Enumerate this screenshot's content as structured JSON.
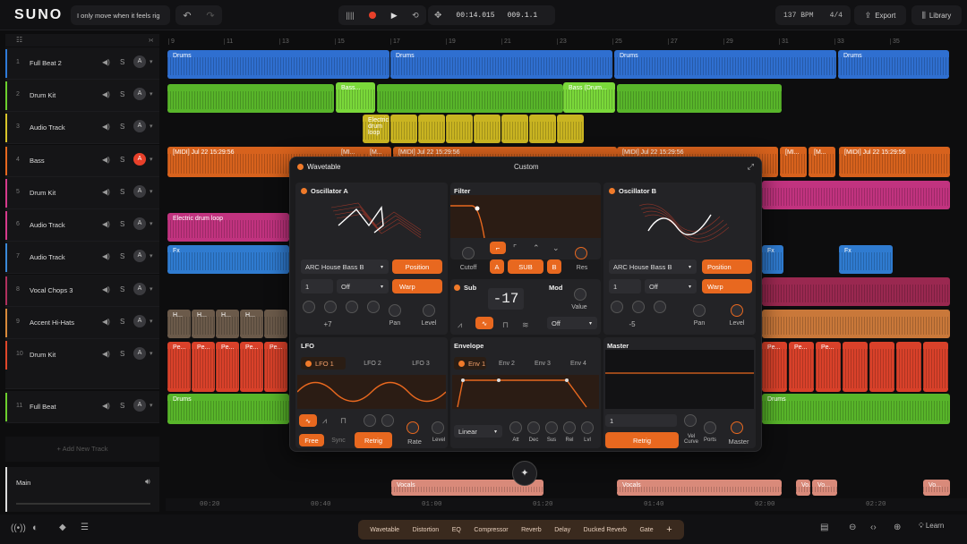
{
  "app": {
    "logo": "SUNO",
    "song_title": "I only move when it feels rig"
  },
  "transport": {
    "time": "00:14.015",
    "bar": "009.1.1"
  },
  "header": {
    "bpm": "137 BPM",
    "signature": "4/4",
    "export": "Export",
    "library": "Library"
  },
  "ruler": [
    "9",
    "11",
    "13",
    "15",
    "17",
    "19",
    "21",
    "23",
    "25",
    "27",
    "29",
    "31",
    "33",
    "35"
  ],
  "tracks": [
    {
      "num": "1",
      "name": "Full Beat 2",
      "color": "#2f7bd9",
      "arm": "A"
    },
    {
      "num": "2",
      "name": "Drum Kit",
      "color": "#6ccf2e",
      "arm": "A"
    },
    {
      "num": "3",
      "name": "Audio Track",
      "color": "#d9c52a",
      "arm": "A"
    },
    {
      "num": "4",
      "name": "Bass",
      "color": "#e8681f",
      "arm": "A"
    },
    {
      "num": "5",
      "name": "Drum Kit",
      "color": "#d63a8c",
      "arm": "A"
    },
    {
      "num": "6",
      "name": "Audio Track",
      "color": "#d63a8c",
      "arm": "A"
    },
    {
      "num": "7",
      "name": "Audio Track",
      "color": "#3a8ad9",
      "arm": "A"
    },
    {
      "num": "8",
      "name": "Vocal Chops 3",
      "color": "#b0305e",
      "arm": "A"
    },
    {
      "num": "9",
      "name": "Accent Hi-Hats",
      "color": "#d98a3a",
      "arm": "A"
    },
    {
      "num": "10",
      "name": "Drum Kit",
      "color": "#e0462a",
      "arm": "A"
    },
    {
      "num": "11",
      "name": "Full Beat",
      "color": "#6ccf2e",
      "arm": "A"
    }
  ],
  "add_track": "Add New Track",
  "main_label": "Main",
  "clips": {
    "drums": "Drums",
    "bass": "Bass...",
    "bass_drum": "Bass (Drum...",
    "edl": "Electric drum loop",
    "midi": "[MIDI] Jul 22 15:29:56",
    "mi": "[M...",
    "mi2": "[MI...",
    "fx": "Fx",
    "h": "H...",
    "pe": "Pe...",
    "vocals": "Vocals",
    "vo": "Vo..."
  },
  "synth": {
    "title": "Wavetable",
    "preset": "Custom",
    "oscA": {
      "title": "Oscillator A",
      "wavetable": "ARC House Bass B",
      "position": "Position",
      "warp": "Warp",
      "octave": "1",
      "mode": "Off",
      "semi": "+7",
      "pan": "Pan",
      "level": "Level"
    },
    "filter": {
      "title": "Filter",
      "cutoff": "Cutoff",
      "res": "Res",
      "a": "A",
      "sub": "SUB",
      "b": "B"
    },
    "sub": {
      "title": "Sub",
      "value": "-17",
      "mod": "Mod",
      "value_label": "Value",
      "off": "Off"
    },
    "oscB": {
      "title": "Oscillator B",
      "wavetable": "ARC House Bass B",
      "position": "Position",
      "warp": "Warp",
      "octave": "1",
      "mode": "Off",
      "semi": "-5",
      "pan": "Pan",
      "level": "Level"
    },
    "lfo": {
      "title": "LFO",
      "tabs": [
        "LFO 1",
        "LFO 2",
        "LFO 3"
      ],
      "free": "Free",
      "sync": "Sync",
      "retrig": "Retrig",
      "rate": "Rate",
      "level": "Level"
    },
    "env": {
      "title": "Envelope",
      "tabs": [
        "Env 1",
        "Env 2",
        "Env 3",
        "Env 4"
      ],
      "curve": "Linear",
      "knobs": [
        "Att",
        "Dec",
        "Sus",
        "Rel",
        "Lvl"
      ]
    },
    "master": {
      "title": "Master",
      "value": "1",
      "retrig": "Retrig",
      "vel": "Vel Curve",
      "ports": "Ports",
      "master": "Master"
    }
  },
  "timeline": [
    "00:20",
    "00:40",
    "01:00",
    "01:20",
    "01:40",
    "02:00",
    "02:20"
  ],
  "fx_chain": [
    "Wavetable",
    "Distortion",
    "EQ",
    "Compressor",
    "Reverb",
    "Delay",
    "Ducked Reverb",
    "Gate"
  ],
  "learn": "Learn"
}
